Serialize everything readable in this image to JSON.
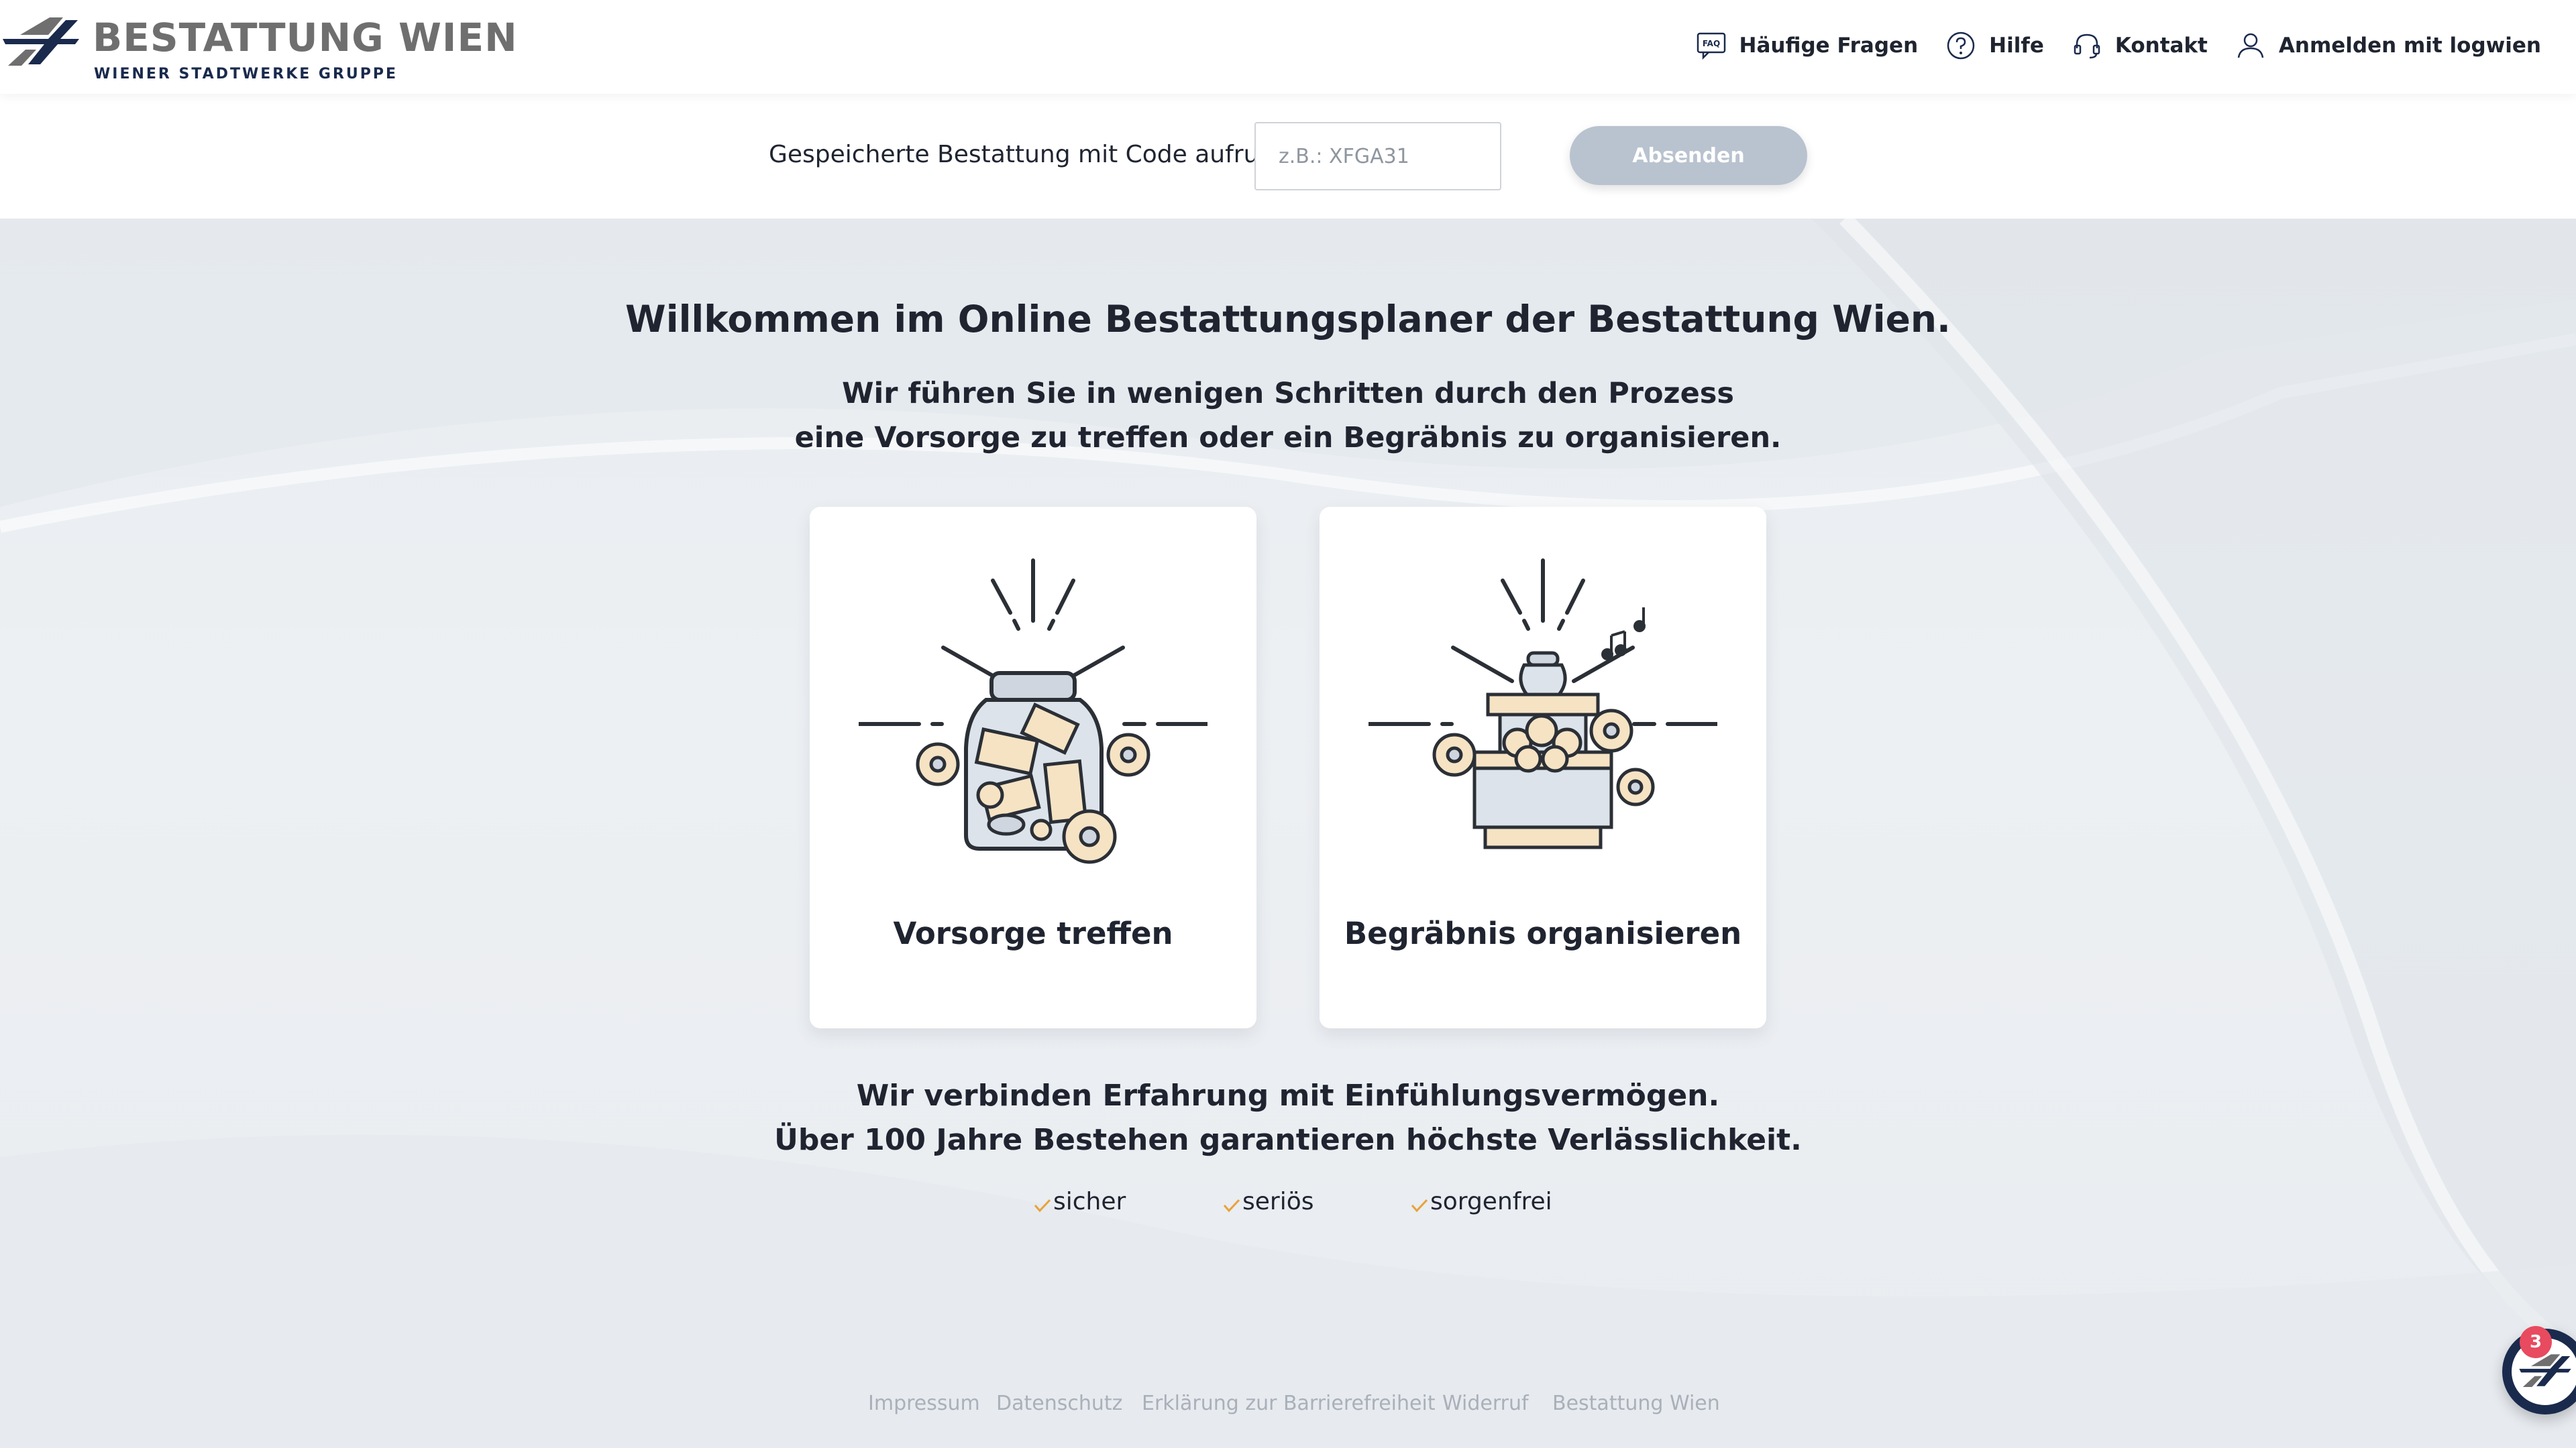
{
  "header": {
    "brand_name": "BESTATTUNG WIEN",
    "brand_sub": "WIENER STADTWERKE GRUPPE",
    "nav": [
      {
        "label": "Häufige Fragen",
        "icon": "faq-icon"
      },
      {
        "label": "Hilfe",
        "icon": "help-icon"
      },
      {
        "label": "Kontakt",
        "icon": "headset-icon"
      },
      {
        "label": "Anmelden mit logwien",
        "icon": "user-icon"
      }
    ]
  },
  "code_bar": {
    "label": "Gespeicherte Bestattung mit Code aufrufen",
    "input_placeholder": "z.B.: XFGA31",
    "input_value": "",
    "submit_label": "Absenden"
  },
  "main": {
    "welcome": "Willkommen im Online Bestattungsplaner der Bestattung Wien.",
    "intro_line1": "Wir führen Sie in wenigen Schritten durch den Prozess",
    "intro_line2": "eine Vorsorge zu treffen oder ein Begräbnis zu organisieren.",
    "cards": [
      {
        "label": "Vorsorge treffen",
        "icon": "money-jar-icon"
      },
      {
        "label": "Begräbnis organisieren",
        "icon": "urn-flowers-icon"
      }
    ],
    "values_line1": "Wir verbinden Erfahrung mit Einfühlungsvermögen.",
    "values_line2": "Über 100 Jahre Bestehen garantieren höchste Verlässlichkeit.",
    "features": [
      "sicher",
      "seriös",
      "sorgenfrei"
    ]
  },
  "footer": {
    "links": [
      "Impressum",
      "Datenschutz",
      "Erklärung zur Barrierefreiheit",
      "Widerruf",
      "Bestattung Wien"
    ]
  },
  "chat": {
    "badge_count": "3",
    "icon": "chat-logo-icon"
  },
  "colors": {
    "brand_navy": "#1a2a4d",
    "brand_grey": "#6f6f6f",
    "check_orange": "#e8a23a",
    "submit_disabled": "#b9c3cf",
    "badge_red": "#e84a5f"
  }
}
